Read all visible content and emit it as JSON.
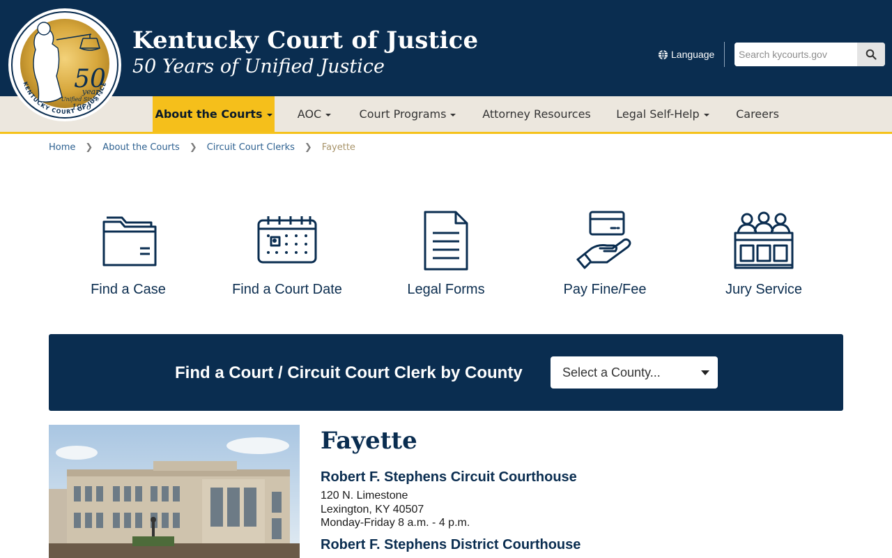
{
  "header": {
    "title": "Kentucky Court of Justice",
    "subtitle": "50 Years of Unified Justice",
    "seal": {
      "big_number": "50",
      "years_word": "years",
      "unified_since": "Unified Since",
      "year": "1976",
      "ring_text": "KENTUCKY COURT OF JUSTICE"
    },
    "language_label": "Language",
    "search_placeholder": "Search kycourts.gov"
  },
  "nav": {
    "items": [
      {
        "label": "About the Courts",
        "active": true,
        "dropdown": true
      },
      {
        "label": "AOC",
        "active": false,
        "dropdown": true
      },
      {
        "label": "Court Programs",
        "active": false,
        "dropdown": true
      },
      {
        "label": "Attorney Resources",
        "active": false,
        "dropdown": false
      },
      {
        "label": "Legal Self-Help",
        "active": false,
        "dropdown": true
      },
      {
        "label": "Careers",
        "active": false,
        "dropdown": false
      }
    ]
  },
  "breadcrumb": {
    "items": [
      "Home",
      "About the Courts",
      "Circuit Court Clerks"
    ],
    "current": "Fayette"
  },
  "quick_links": [
    {
      "label": "Find a Case",
      "icon": "folder-icon"
    },
    {
      "label": "Find a Court Date",
      "icon": "calendar-icon"
    },
    {
      "label": "Legal Forms",
      "icon": "document-icon"
    },
    {
      "label": "Pay Fine/Fee",
      "icon": "card-hand-icon"
    },
    {
      "label": "Jury Service",
      "icon": "jury-box-icon"
    }
  ],
  "finder": {
    "label": "Find a Court / Circuit Court Clerk by County",
    "select_value": "Select a County..."
  },
  "county": {
    "name": "Fayette",
    "courthouses": [
      {
        "name": "Robert F. Stephens Circuit Courthouse",
        "street": "120 N. Limestone",
        "city": "Lexington, KY 40507",
        "hours": "Monday-Friday 8 a.m. - 4 p.m."
      },
      {
        "name": "Robert F. Stephens District Courthouse"
      }
    ]
  },
  "colors": {
    "navy": "#0a2d50",
    "gold": "#f5bf1b",
    "nav_bg": "#ece7de",
    "link": "#2b5f8f"
  }
}
